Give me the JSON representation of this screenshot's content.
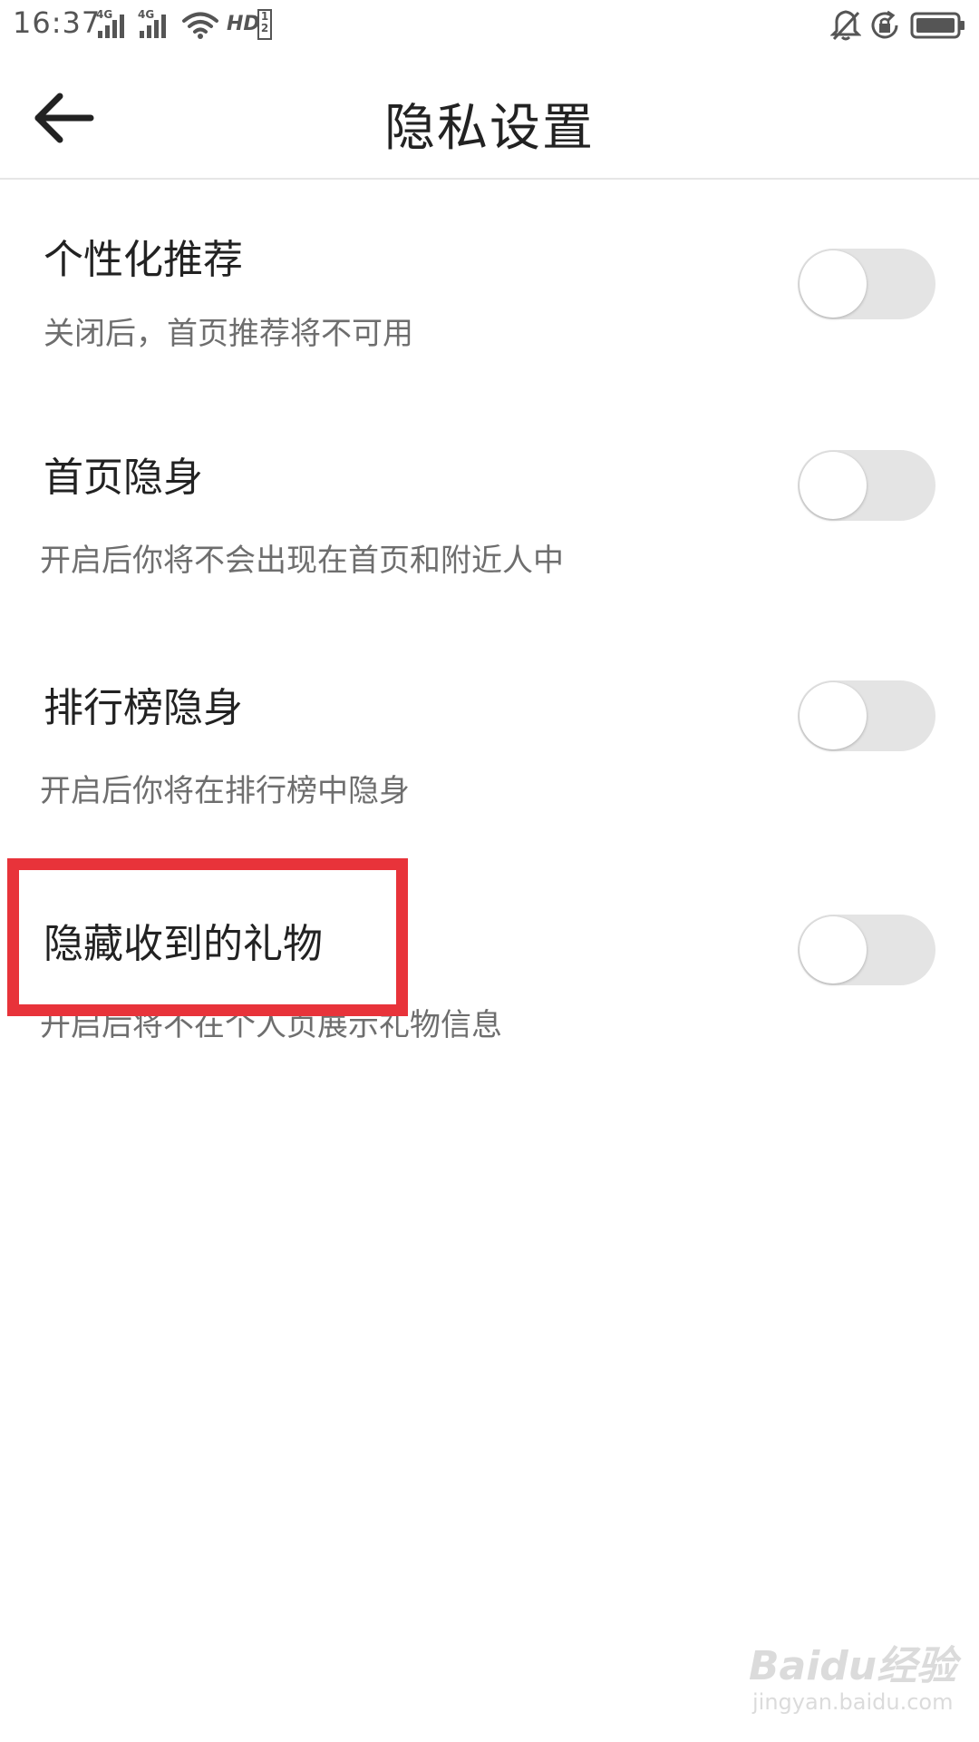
{
  "status_bar": {
    "time": "16:37",
    "signal_1_tag": "4G",
    "signal_2_tag": "4G",
    "icons": [
      "signal-4g-icon",
      "signal-4g-icon",
      "wifi-icon",
      "hd-volte-icon",
      "bell-off-icon",
      "rotation-lock-icon",
      "battery-icon"
    ]
  },
  "app_bar": {
    "back_icon": "back-arrow-icon",
    "title": "隐私设置"
  },
  "settings": [
    {
      "title": "个性化推荐",
      "description": "关闭后，首页推荐将不可用",
      "enabled": false
    },
    {
      "title": "首页隐身",
      "description": "开启后你将不会出现在首页和附近人中",
      "enabled": false
    },
    {
      "title": "排行榜隐身",
      "description": "开启后你将在排行榜中隐身",
      "enabled": false
    },
    {
      "title": "隐藏收到的礼物",
      "description": "开启后将不在个人页展示礼物信息",
      "enabled": false
    }
  ],
  "highlight": {
    "color": "#e8333a"
  },
  "watermark": {
    "logo": "Baidu经验",
    "sub": "jingyan.baidu.com"
  }
}
